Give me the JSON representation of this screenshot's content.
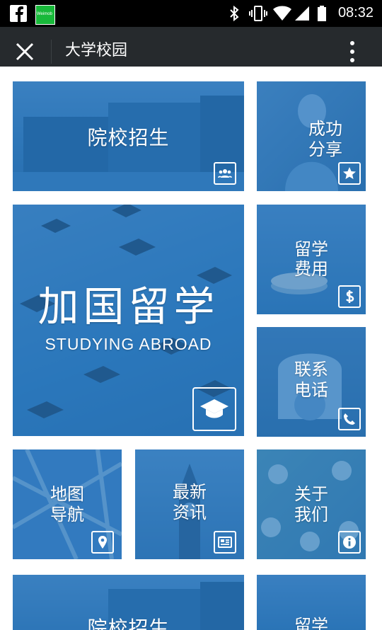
{
  "status_bar": {
    "time": "08:32",
    "app_badge": "Weimob"
  },
  "header": {
    "title": "大学校园"
  },
  "tiles": {
    "admissions": {
      "label": "院校招生",
      "icon": "group-icon"
    },
    "success": {
      "line1": "成功",
      "line2": "分享",
      "icon": "star-icon"
    },
    "abroad": {
      "title": "加国留学",
      "subtitle": "STUDYING ABROAD",
      "icon": "graduation-cap-icon"
    },
    "fees": {
      "line1": "留学",
      "line2": "费用",
      "icon": "dollar-icon"
    },
    "contact": {
      "line1": "联系",
      "line2": "电话",
      "icon": "phone-icon"
    },
    "map": {
      "line1": "地图",
      "line2": "导航",
      "icon": "map-pin-icon"
    },
    "news": {
      "line1": "最新",
      "line2": "资讯",
      "icon": "news-icon"
    },
    "about": {
      "line1": "关于",
      "line2": "我们",
      "icon": "info-icon"
    },
    "admissions_repeat": {
      "label": "院校招生"
    },
    "study_repeat": {
      "line1": "留学"
    }
  },
  "colors": {
    "tile_blue": "#2f7fc0",
    "header_bg": "#262a2d"
  }
}
